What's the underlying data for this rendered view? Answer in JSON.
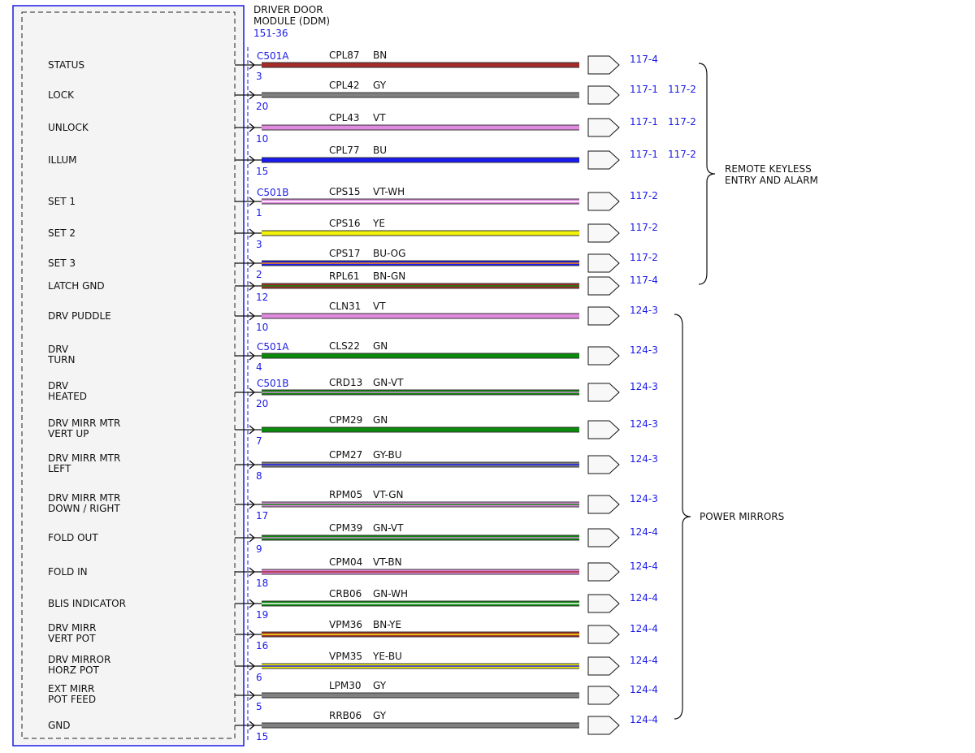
{
  "module": {
    "title_line1": "DRIVER DOOR",
    "title_line2": "MODULE (DDM)",
    "ref": "151-36"
  },
  "colors": {
    "BN": "#a52a2a",
    "GY": "#808080",
    "VT": "#e08ae0",
    "BU": "#1a1aee",
    "WH": "#ffffff",
    "YE": "#f2f20a",
    "OG": "#ff8c00",
    "GN": "#0a8a0a",
    "outline": "#1a1ae6"
  },
  "wires": [
    {
      "label": [
        "STATUS"
      ],
      "connector": "C501A",
      "pin": "3",
      "circuit": "CPL87",
      "color": "BN",
      "base": "BN",
      "stripe": "",
      "refs": [
        "117-4"
      ]
    },
    {
      "label": [
        "LOCK"
      ],
      "connector": "",
      "pin": "20",
      "circuit": "CPL42",
      "color": "GY",
      "base": "GY",
      "stripe": "",
      "refs": [
        "117-1",
        "117-2"
      ]
    },
    {
      "label": [
        "UNLOCK"
      ],
      "connector": "",
      "pin": "10",
      "circuit": "CPL43",
      "color": "VT",
      "base": "VT",
      "stripe": "",
      "refs": [
        "117-1",
        "117-2"
      ]
    },
    {
      "label": [
        "ILLUM"
      ],
      "connector": "",
      "pin": "15",
      "circuit": "CPL77",
      "color": "BU",
      "base": "BU",
      "stripe": "",
      "refs": [
        "117-1",
        "117-2"
      ]
    },
    {
      "label": [
        "SET 1"
      ],
      "connector": "C501B",
      "pin": "1",
      "circuit": "CPS15",
      "color": "VT-WH",
      "base": "VT",
      "stripe": "WH",
      "refs": [
        "117-2"
      ]
    },
    {
      "label": [
        "SET 2"
      ],
      "connector": "",
      "pin": "3",
      "circuit": "CPS16",
      "color": "YE",
      "base": "YE",
      "stripe": "",
      "refs": [
        "117-2"
      ]
    },
    {
      "label": [
        "SET 3"
      ],
      "connector": "",
      "pin": "2",
      "circuit": "CPS17",
      "color": "BU-OG",
      "base": "BU",
      "stripe": "OG",
      "refs": [
        "117-2"
      ]
    },
    {
      "label": [
        "LATCH GND"
      ],
      "connector": "",
      "pin": "12",
      "circuit": "RPL61",
      "color": "BN-GN",
      "base": "BN",
      "stripe": "GN",
      "refs": [
        "117-4"
      ]
    },
    {
      "label": [
        "DRV PUDDLE"
      ],
      "connector": "",
      "pin": "10",
      "circuit": "CLN31",
      "color": "VT",
      "base": "VT",
      "stripe": "",
      "refs": [
        "124-3"
      ]
    },
    {
      "label": [
        "DRV",
        "TURN"
      ],
      "connector": "C501A",
      "pin": "4",
      "circuit": "CLS22",
      "color": "GN",
      "base": "GN",
      "stripe": "",
      "refs": [
        "124-3"
      ]
    },
    {
      "label": [
        "DRV",
        "HEATED"
      ],
      "connector": "C501B",
      "pin": "20",
      "circuit": "CRD13",
      "color": "GN-VT",
      "base": "GN",
      "stripe": "VT",
      "refs": [
        "124-3"
      ]
    },
    {
      "label": [
        "DRV MIRR MTR",
        "VERT UP"
      ],
      "connector": "",
      "pin": "7",
      "circuit": "CPM29",
      "color": "GN",
      "base": "GN",
      "stripe": "",
      "refs": [
        "124-3"
      ]
    },
    {
      "label": [
        "DRV MIRR MTR",
        "LEFT"
      ],
      "connector": "",
      "pin": "8",
      "circuit": "CPM27",
      "color": "GY-BU",
      "base": "GY",
      "stripe": "BU",
      "refs": [
        "124-3"
      ]
    },
    {
      "label": [
        "DRV MIRR MTR",
        "DOWN / RIGHT"
      ],
      "connector": "",
      "pin": "17",
      "circuit": "RPM05",
      "color": "VT-GN",
      "base": "VT",
      "stripe": "GN",
      "refs": [
        "124-3"
      ]
    },
    {
      "label": [
        "FOLD OUT"
      ],
      "connector": "",
      "pin": "9",
      "circuit": "CPM39",
      "color": "GN-VT",
      "base": "GN",
      "stripe": "VT",
      "refs": [
        "124-4"
      ]
    },
    {
      "label": [
        "FOLD IN"
      ],
      "connector": "",
      "pin": "18",
      "circuit": "CPM04",
      "color": "VT-BN",
      "base": "VT",
      "stripe": "BN",
      "refs": [
        "124-4"
      ]
    },
    {
      "label": [
        "BLIS INDICATOR"
      ],
      "connector": "",
      "pin": "19",
      "circuit": "CRB06",
      "color": "GN-WH",
      "base": "GN",
      "stripe": "WH",
      "refs": [
        "124-4"
      ]
    },
    {
      "label": [
        "DRV MIRR",
        "VERT POT"
      ],
      "connector": "",
      "pin": "16",
      "circuit": "VPM36",
      "color": "BN-YE",
      "base": "BN",
      "stripe": "YE",
      "refs": [
        "124-4"
      ]
    },
    {
      "label": [
        "DRV MIRROR",
        "HORZ POT"
      ],
      "connector": "",
      "pin": "6",
      "circuit": "VPM35",
      "color": "YE-BU",
      "base": "YE",
      "stripe": "BU",
      "refs": [
        "124-4"
      ]
    },
    {
      "label": [
        "EXT MIRR",
        "POT FEED"
      ],
      "connector": "",
      "pin": "5",
      "circuit": "LPM30",
      "color": "GY",
      "base": "GY",
      "stripe": "",
      "refs": [
        "124-4"
      ]
    },
    {
      "label": [
        "GND"
      ],
      "connector": "",
      "pin": "15",
      "circuit": "RRB06",
      "color": "GY",
      "base": "GY",
      "stripe": "",
      "refs": [
        "124-4"
      ]
    }
  ],
  "groups": [
    {
      "label": [
        "REMOTE KEYLESS",
        "ENTRY AND ALARM"
      ],
      "first": 0,
      "last": 7
    },
    {
      "label": [
        "POWER MIRRORS"
      ],
      "first": 8,
      "last": 20
    }
  ]
}
